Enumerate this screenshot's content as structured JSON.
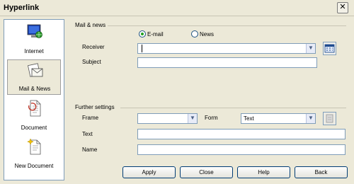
{
  "window": {
    "title": "Hyperlink",
    "close_glyph": "✕"
  },
  "sidebar": {
    "items": [
      {
        "label": "Internet",
        "icon": "globe-monitor-icon",
        "selected": false
      },
      {
        "label": "Mail & News",
        "icon": "mail-icon",
        "selected": true
      },
      {
        "label": "Document",
        "icon": "document-icon",
        "selected": false
      },
      {
        "label": "New Document",
        "icon": "new-document-icon",
        "selected": false
      }
    ]
  },
  "mail_news": {
    "section_title": "Mail & news",
    "radio_email": {
      "label": "E-mail",
      "checked": true
    },
    "radio_news": {
      "label": "News",
      "checked": false
    },
    "receiver_label": "Receiver",
    "receiver_value": "",
    "subject_label": "Subject",
    "subject_value": ""
  },
  "further": {
    "section_title": "Further settings",
    "frame_label": "Frame",
    "frame_value": "",
    "form_label": "Form",
    "form_value": "Text",
    "text_label": "Text",
    "text_value": "",
    "name_label": "Name",
    "name_value": ""
  },
  "buttons": {
    "apply": "Apply",
    "close": "Close",
    "help": "Help",
    "back": "Back"
  },
  "colors": {
    "dialog_bg": "#ece9d8",
    "field_border": "#7f9db9",
    "button_border": "#003c74"
  }
}
